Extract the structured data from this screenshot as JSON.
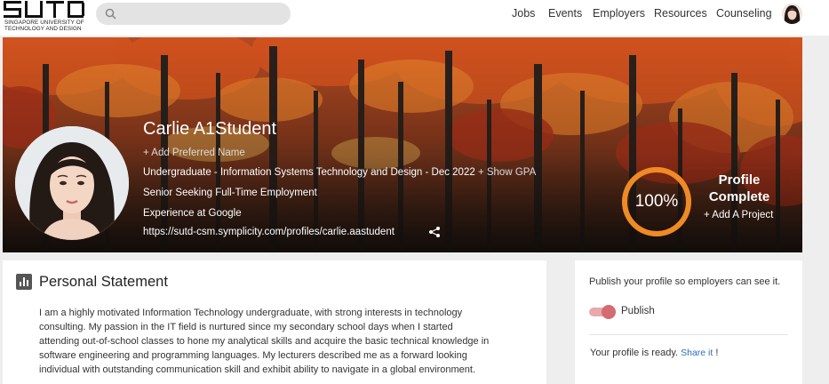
{
  "header": {
    "logo": {
      "mark": "SUTD",
      "line1": "SINGAPORE UNIVERSITY OF",
      "line2": "TECHNOLOGY AND DESIGN"
    },
    "search": {
      "value": "",
      "placeholder": ""
    },
    "nav": [
      "Jobs",
      "Events",
      "Employers",
      "Resources",
      "Counseling"
    ]
  },
  "profile": {
    "name": "Carlie A1Student",
    "add_preferred_name": "+ Add Preferred Name",
    "program": "Undergraduate - Information Systems Technology and Design -  Dec 2022",
    "show_gpa": "+ Show GPA",
    "status": "Senior Seeking Full-Time Employment",
    "experience": "Experience at Google",
    "url": "https://sutd-csm.symplicity.com/profiles/carlie.aastudent"
  },
  "completion": {
    "percent_text": "100%",
    "percent": 100,
    "label_line1": "Profile",
    "label_line2": "Complete",
    "add_project": "+ Add A Project"
  },
  "personal_statement": {
    "title": "Personal Statement",
    "lines": [
      "I am a highly motivated Information Technology undergraduate, with strong interests in technology",
      "consulting. My passion in the IT field is nurtured since my secondary school days when I started",
      "attending out-of-school classes to hone my analytical skills and acquire the basic technical knowledge in",
      "software engineering and programming languages. My lecturers described me as a forward looking",
      "individual with outstanding communication skill and exhibit ability to navigate in a global environment."
    ]
  },
  "publish": {
    "help": "Publish your profile so employers can see it.",
    "toggle_label": "Publish",
    "toggle_on": true,
    "ready_text": "Your profile is ready.",
    "share_link": "Share it",
    "ready_suffix": "!"
  },
  "colors": {
    "ring": "#f08a24",
    "toggle_knob": "#d46a72",
    "link": "#2c6db5"
  },
  "icons": [
    "search-icon",
    "share-icon",
    "bar-chart-icon"
  ]
}
